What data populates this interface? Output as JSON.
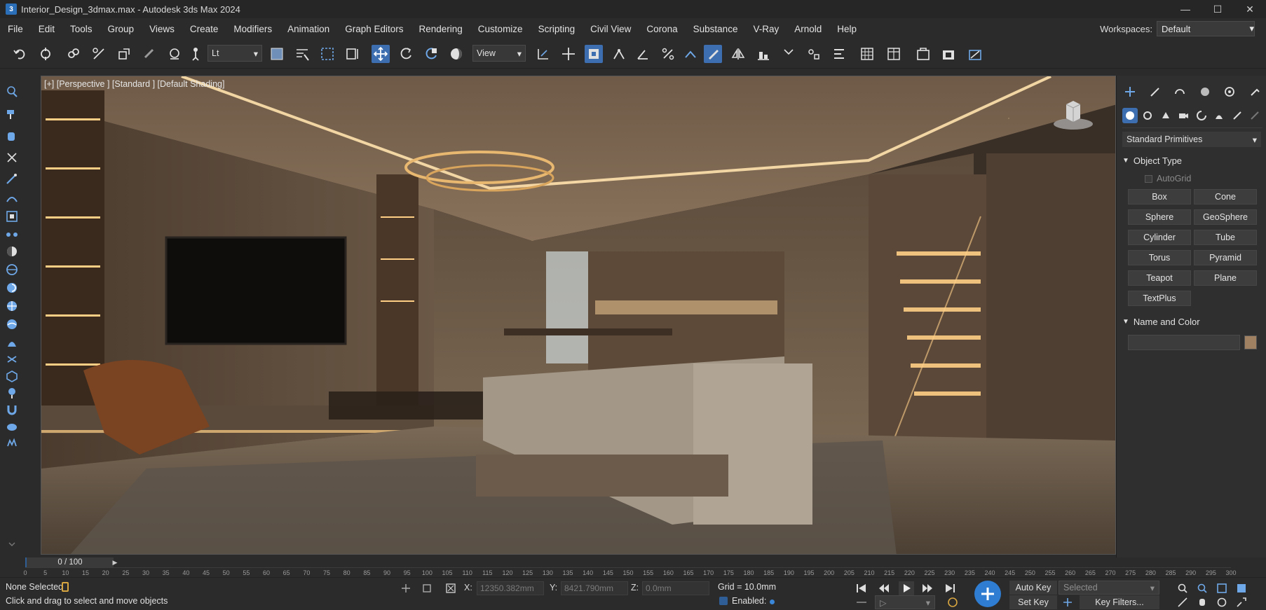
{
  "window": {
    "title": "Interior_Design_3dmax.max - Autodesk 3ds Max 2024",
    "app_icon_letter": "3",
    "controls": [
      "minimize-icon",
      "maximize-icon",
      "close-icon"
    ]
  },
  "menu": [
    "File",
    "Edit",
    "Tools",
    "Group",
    "Views",
    "Create",
    "Modifiers",
    "Animation",
    "Graph Editors",
    "Rendering",
    "Customize",
    "Scripting",
    "Civil View",
    "Corona",
    "Substance",
    "V-Ray",
    "Arnold",
    "Help"
  ],
  "workspaces": {
    "label": "Workspaces:",
    "value": "Default"
  },
  "toolbar": {
    "selection_filter": "Lt",
    "reference_coord": "View"
  },
  "viewport": {
    "label": "[+] [Perspective ] [Standard ] [Default Shading]"
  },
  "command_panel": {
    "category": "Standard Primitives",
    "object_type_title": "Object Type",
    "autogrid_label": "AutoGrid",
    "buttons": [
      "Box",
      "Cone",
      "Sphere",
      "GeoSphere",
      "Cylinder",
      "Tube",
      "Torus",
      "Pyramid",
      "Teapot",
      "Plane",
      "TextPlus"
    ],
    "name_color_title": "Name and Color",
    "object_color": "#a08262"
  },
  "timeline": {
    "frame_display": "0 / 100",
    "ticks": [
      "0",
      "5",
      "10",
      "15",
      "20",
      "25",
      "30",
      "35",
      "40",
      "45",
      "50",
      "55",
      "60",
      "65",
      "70",
      "75",
      "80",
      "85",
      "90",
      "95",
      "100",
      "105",
      "110",
      "115",
      "120",
      "125",
      "130",
      "135",
      "140",
      "145",
      "150",
      "155",
      "160",
      "165",
      "170",
      "175",
      "180",
      "185",
      "190",
      "195",
      "200",
      "205",
      "210",
      "215",
      "220",
      "225",
      "230",
      "235",
      "240",
      "245",
      "250",
      "255",
      "260",
      "265",
      "270",
      "275",
      "280",
      "285",
      "290",
      "295",
      "300"
    ]
  },
  "status": {
    "selection": "None Selected",
    "prompt": "Click and drag to select and move objects",
    "x_label": "X:",
    "x_value": "12350.382mm",
    "y_label": "Y:",
    "y_value": "8421.790mm",
    "z_label": "Z:",
    "z_value": "0.0mm",
    "grid": "Grid = 10.0mm",
    "enabled": "Enabled:",
    "auto_key": "Auto Key",
    "selected_option": "Selected",
    "set_key": "Set Key",
    "key_filters": "Key Filters..."
  },
  "accent_color": "#3d6fb0"
}
